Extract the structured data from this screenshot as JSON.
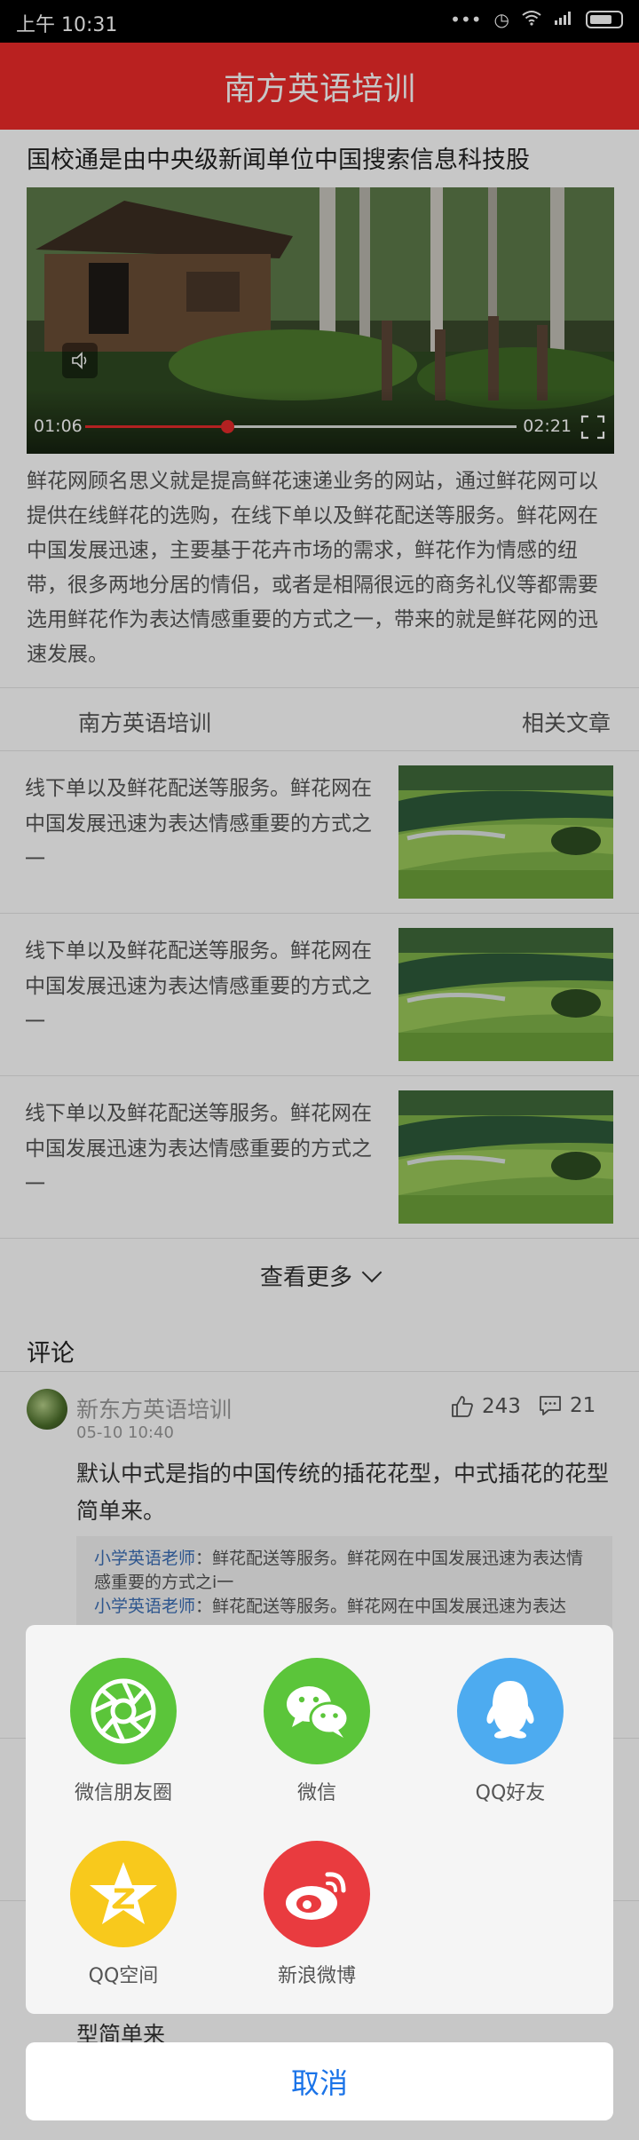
{
  "status_bar": {
    "time": "上午 10:31",
    "icons": [
      "more-dots-icon",
      "alarm-icon",
      "wifi-icon",
      "signal-icon",
      "battery-icon"
    ]
  },
  "app_bar": {
    "title": "南方英语培训",
    "color": "#ee2b2a"
  },
  "article": {
    "title": "国校通是由中央级新闻单位中国搜索信息科技股",
    "video": {
      "current_time": "01:06",
      "duration": "02:21",
      "progress": 0.33
    },
    "body": "鲜花网顾名思义就是提高鲜花速递业务的网站，通过鲜花网可以提供在线鲜花的选购，在线下单以及鲜花配送等服务。鲜花网在中国发展迅速，主要基于花卉市场的需求，鲜花作为情感的纽带，很多两地分居的情侣，或者是相隔很远的商务礼仪等都需要选用鲜花作为表达情感重要的方式之一，带来的就是鲜花网的迅速发展。"
  },
  "tabs": {
    "left": "南方英语培训",
    "right": "相关文章"
  },
  "news": [
    {
      "text": "线下单以及鲜花配送等服务。鲜花网在中国发展迅速为表达情感重要的方式之一"
    },
    {
      "text": "线下单以及鲜花配送等服务。鲜花网在中国发展迅速为表达情感重要的方式之一"
    },
    {
      "text": "线下单以及鲜花配送等服务。鲜花网在中国发展迅速为表达情感重要的方式之一"
    }
  ],
  "more_label": "查看更多",
  "comments": {
    "title": "评论",
    "items": [
      {
        "user": "新东方英语培训",
        "date": "05-10  10:40",
        "likes": "243",
        "replies_count": "21",
        "text": "默认中式是指的中国传统的插花花型，中式插花的花型简单来。",
        "replies": [
          {
            "name": "小学英语老师",
            "text": "：鲜花配送等服务。鲜花网在中国发展迅速为表达情感重要的方式之i一"
          },
          {
            "name": "小学英语老师",
            "text": "：鲜花配送等服务。鲜花网在中国发展迅速为表达"
          }
        ]
      }
    ],
    "behind_text": "型简单来"
  },
  "share": {
    "items": [
      {
        "label": "微信朋友圈",
        "icon": "wechat-moments-icon",
        "color": "#5bc53a"
      },
      {
        "label": "微信",
        "icon": "wechat-icon",
        "color": "#5bc53a"
      },
      {
        "label": "QQ好友",
        "icon": "qq-icon",
        "color": "#4dabf0"
      },
      {
        "label": "QQ空间",
        "icon": "qzone-icon",
        "color": "#f8c91c"
      },
      {
        "label": "新浪微博",
        "icon": "weibo-icon",
        "color": "#e93b3f"
      }
    ],
    "cancel_label": "取消",
    "cancel_color": "#1a73e8"
  }
}
